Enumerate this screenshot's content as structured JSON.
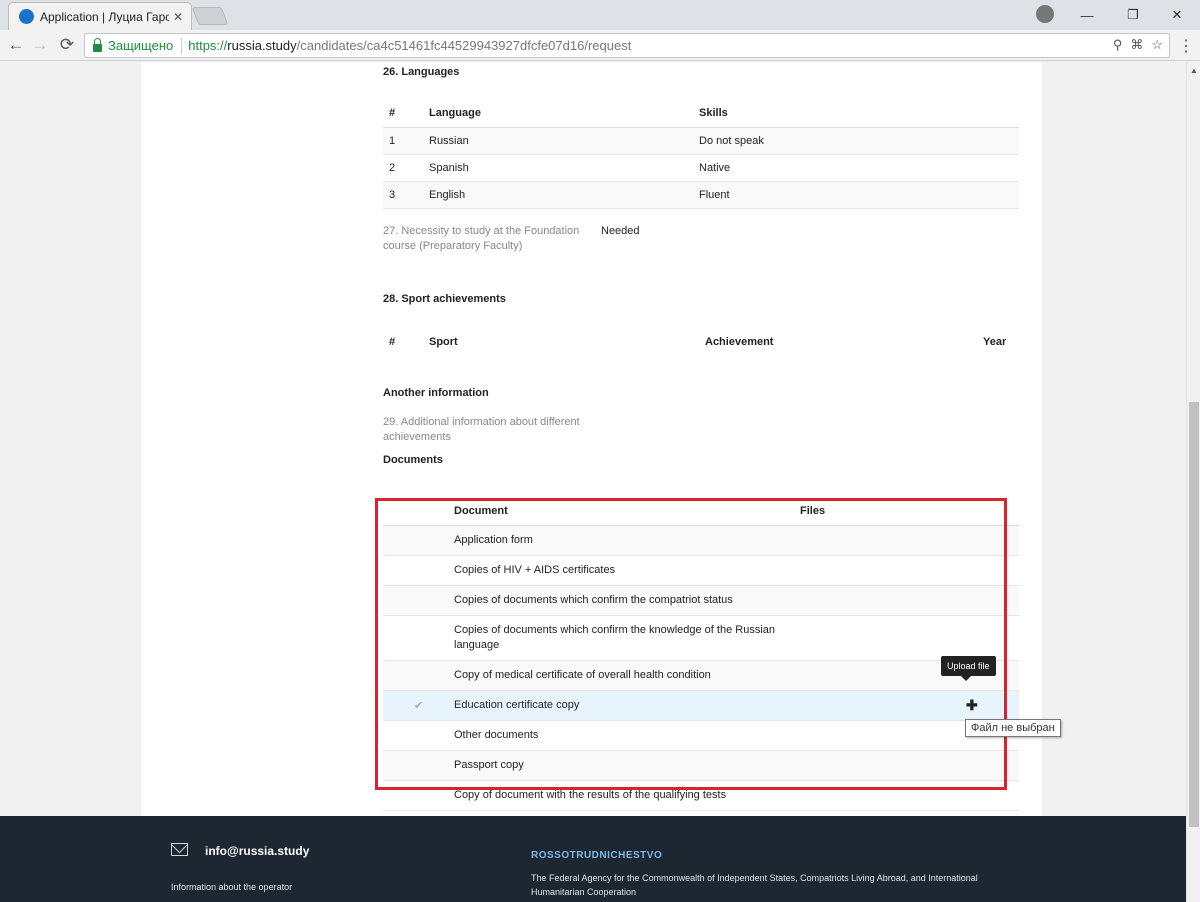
{
  "browser": {
    "tab_title": "Application | Луциа Гарс",
    "tab_close": "✕",
    "secure_label": "Защищено",
    "url_scheme": "https://",
    "url_host": "russia.study",
    "url_path": "/candidates/ca4c51461fc44529943927dfcfe07d16/request",
    "nav_back": "←",
    "nav_forward": "→",
    "nav_reload": "⟳",
    "zoom_icon": "⚲",
    "translate_icon": "⌘",
    "bookmark_icon": "☆",
    "menu_icon": "⋮",
    "win_minimize": "—",
    "win_restore": "❐",
    "win_close": "✕"
  },
  "languages": {
    "heading": "26. Languages",
    "columns": [
      "#",
      "Language",
      "Skills"
    ],
    "rows": [
      {
        "num": "1",
        "language": "Russian",
        "skill": "Do not speak"
      },
      {
        "num": "2",
        "language": "Spanish",
        "skill": "Native"
      },
      {
        "num": "3",
        "language": "English",
        "skill": "Fluent"
      }
    ]
  },
  "foundation": {
    "label": "27. Necessity to study at the Foundation course (Preparatory Faculty)",
    "value": "Needed"
  },
  "sport": {
    "heading": "28. Sport achievements",
    "columns": [
      "#",
      "Sport",
      "Achievement",
      "Year"
    ]
  },
  "another": {
    "heading": "Another information",
    "additional_label": "29. Additional information about different achievements"
  },
  "documents": {
    "heading": "Documents",
    "columns": [
      "",
      "Document",
      "Files"
    ],
    "rows": [
      {
        "name": "Application form",
        "checked": false
      },
      {
        "name": "Copies of HIV + AIDS certificates",
        "checked": false
      },
      {
        "name": "Copies of documents which confirm the compatriot status",
        "checked": false
      },
      {
        "name": "Copies of documents which confirm the knowledge of the Russian language",
        "checked": false
      },
      {
        "name": "Copy of medical certificate of overall health condition",
        "checked": false
      },
      {
        "name": "Education certificate copy",
        "checked": true
      },
      {
        "name": "Other documents",
        "checked": false
      },
      {
        "name": "Passport copy",
        "checked": false
      },
      {
        "name": "Copy of document with the results of the qualifying tests",
        "checked": false
      }
    ],
    "check_glyph": "✔",
    "upload_glyph": "✚",
    "upload_tooltip": "Upload file",
    "no_file_tooltip": "Файл не выбран"
  },
  "footer": {
    "email": "info@russia.study",
    "operator": "Information about the operator",
    "org_name": "ROSSOTRUDNICHESTVO",
    "org_desc": "The Federal Agency for the Commonwealth of Independent States, Compatriots Living Abroad, and International Humanitarian Cooperation"
  },
  "colors": {
    "highlight": "#d9232d",
    "footer_bg": "#1c2731",
    "org_accent": "#7db8e8",
    "secure_green": "#1e8e3e"
  }
}
